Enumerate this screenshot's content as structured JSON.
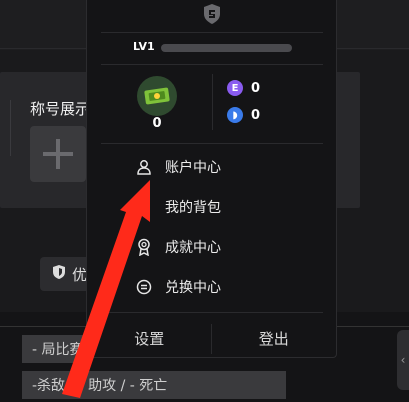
{
  "background": {
    "title_partial": "称号展示",
    "badge_char": "优",
    "chip1": "- 局比赛",
    "chip2": "-杀敌 / - 助攻 / - 死亡"
  },
  "dropdown": {
    "level_label": "LV1",
    "level_progress": 0,
    "medal_count": "0",
    "currency_e": "0",
    "currency_b": "0",
    "menu": [
      {
        "label": "账户中心",
        "icon": "user-icon"
      },
      {
        "label": "我的背包",
        "icon": "backpack-icon"
      },
      {
        "label": "成就中心",
        "icon": "medal-icon"
      },
      {
        "label": "兑换中心",
        "icon": "exchange-icon"
      }
    ],
    "settings_label": "设置",
    "logout_label": "登出"
  },
  "colors": {
    "arrow": "#ff2a1a",
    "currency_e": "#8a5cf0",
    "currency_b": "#3a7bea"
  }
}
